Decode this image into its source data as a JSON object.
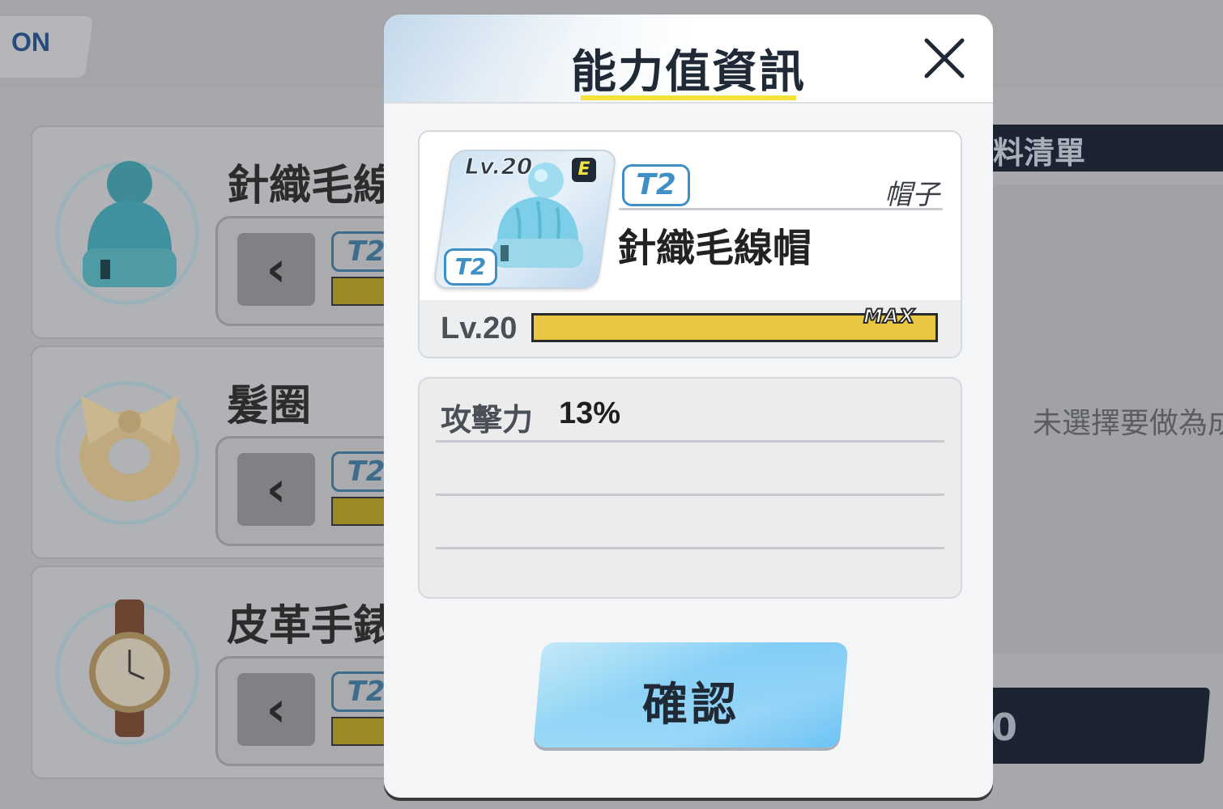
{
  "background": {
    "mode_tab_label": "ON",
    "equipment_list": [
      {
        "name": "針織毛線",
        "tier": "T2"
      },
      {
        "name": "髮圈",
        "tier": "T2"
      },
      {
        "name": "皮革手錶",
        "tier": "T2"
      }
    ],
    "right_panel_header": "料清單",
    "right_panel_message": "未選擇要做為成",
    "right_button_text": "0"
  },
  "modal": {
    "title": "能力值資訊",
    "item": {
      "level_badge": "Lv.20",
      "equip_badge": "E",
      "icon_tier": "T2",
      "tier": "T2",
      "type": "帽子",
      "name": "針織毛線帽",
      "level_label": "Lv.20",
      "level_progress": 1.0,
      "max_label": "MAX"
    },
    "stats": [
      {
        "name": "攻擊力",
        "value": "13%"
      },
      {
        "name": "",
        "value": ""
      },
      {
        "name": "",
        "value": ""
      }
    ],
    "confirm_label": "確認"
  },
  "colors": {
    "accent_blue": "#3e8fc6",
    "level_bar": "#e8c843",
    "title_underline": "#f3e23c",
    "confirm_button": "#89d1f6"
  }
}
